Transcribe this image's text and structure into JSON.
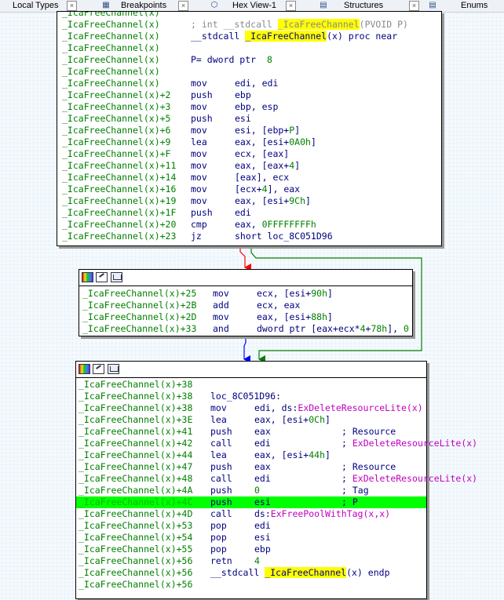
{
  "tabs": [
    {
      "label": "Local Types",
      "close": "×"
    },
    {
      "label": "Breakpoints",
      "close": "×"
    },
    {
      "label": "Hex View-1",
      "close": "×"
    },
    {
      "label": "Structures",
      "close": "×"
    },
    {
      "label": "Enums",
      "close": ""
    }
  ],
  "block1": [
    {
      "addr": "_IcaFreeChannel(x)",
      "mnem": "",
      "ops": "; int __stdcall <h>_IcaFreeChannel</h><g>(PVOID P)</g>",
      "gray": true
    },
    {
      "addr": "_IcaFreeChannel(x)",
      "mnem": "",
      "ops": "__stdcall <h>_IcaFreeChannel</h>(x) proc near"
    },
    {
      "addr": "_IcaFreeChannel(x)",
      "mnem": "",
      "ops": ""
    },
    {
      "addr": "_IcaFreeChannel(x)",
      "mnem": "",
      "ops": "P= dword ptr  <n>8</n>"
    },
    {
      "addr": "_IcaFreeChannel(x)",
      "mnem": "",
      "ops": ""
    },
    {
      "addr": "_IcaFreeChannel(x)",
      "mnem": "mov",
      "ops": "edi, edi"
    },
    {
      "addr": "_IcaFreeChannel(x)+2",
      "mnem": "push",
      "ops": "ebp"
    },
    {
      "addr": "_IcaFreeChannel(x)+3",
      "mnem": "mov",
      "ops": "ebp, esp"
    },
    {
      "addr": "_IcaFreeChannel(x)+5",
      "mnem": "push",
      "ops": "esi"
    },
    {
      "addr": "_IcaFreeChannel(x)+6",
      "mnem": "mov",
      "ops": "esi, [ebp+<n>P</n>]"
    },
    {
      "addr": "_IcaFreeChannel(x)+9",
      "mnem": "lea",
      "ops": "eax, [esi+<n>0A0h</n>]"
    },
    {
      "addr": "_IcaFreeChannel(x)+F",
      "mnem": "mov",
      "ops": "ecx, [eax]"
    },
    {
      "addr": "_IcaFreeChannel(x)+11",
      "mnem": "mov",
      "ops": "eax, [eax+<n>4</n>]"
    },
    {
      "addr": "_IcaFreeChannel(x)+14",
      "mnem": "mov",
      "ops": "[eax], ecx"
    },
    {
      "addr": "_IcaFreeChannel(x)+16",
      "mnem": "mov",
      "ops": "[ecx+<n>4</n>], eax"
    },
    {
      "addr": "_IcaFreeChannel(x)+19",
      "mnem": "mov",
      "ops": "eax, [esi+<n>9Ch</n>]"
    },
    {
      "addr": "_IcaFreeChannel(x)+1F",
      "mnem": "push",
      "ops": "edi"
    },
    {
      "addr": "_IcaFreeChannel(x)+20",
      "mnem": "cmp",
      "ops": "eax, <n>0FFFFFFFFh</n>"
    },
    {
      "addr": "_IcaFreeChannel(x)+23",
      "mnem": "jz",
      "ops": "short loc_8C051D96"
    }
  ],
  "block1_partial_top": "_IcaFreeChannel(x)",
  "block2": [
    {
      "addr": "_IcaFreeChannel(x)+25",
      "mnem": "mov",
      "ops": "ecx, [esi+<n>90h</n>]"
    },
    {
      "addr": "_IcaFreeChannel(x)+2B",
      "mnem": "add",
      "ops": "ecx, eax"
    },
    {
      "addr": "_IcaFreeChannel(x)+2D",
      "mnem": "mov",
      "ops": "eax, [esi+<n>88h</n>]"
    },
    {
      "addr": "_IcaFreeChannel(x)+33",
      "mnem": "and",
      "ops": "dword ptr [eax+ecx*<n>4</n>+<n>78h</n>], <n>0</n>"
    }
  ],
  "block3": [
    {
      "addr": "_IcaFreeChannel(x)+38",
      "mnem": "",
      "ops": ""
    },
    {
      "addr": "_IcaFreeChannel(x)+38",
      "mnem": "loc_8C051D96:",
      "ops": ""
    },
    {
      "addr": "_IcaFreeChannel(x)+38",
      "mnem": "mov",
      "ops": "edi, ds:<i>ExDeleteResourceLite(x)</i>"
    },
    {
      "addr": "_IcaFreeChannel(x)+3E",
      "mnem": "lea",
      "ops": "eax, [esi+<n>0Ch</n>]"
    },
    {
      "addr": "_IcaFreeChannel(x)+41",
      "mnem": "push",
      "ops": "eax",
      "cmt": "; Resource"
    },
    {
      "addr": "_IcaFreeChannel(x)+42",
      "mnem": "call",
      "ops": "edi",
      "cmt": "; <i>ExDeleteResourceLite(x)</i>"
    },
    {
      "addr": "_IcaFreeChannel(x)+44",
      "mnem": "lea",
      "ops": "eax, [esi+<n>44h</n>]"
    },
    {
      "addr": "_IcaFreeChannel(x)+47",
      "mnem": "push",
      "ops": "eax",
      "cmt": "; Resource"
    },
    {
      "addr": "_IcaFreeChannel(x)+48",
      "mnem": "call",
      "ops": "edi",
      "cmt": "; <i>ExDeleteResourceLite(x)</i>"
    },
    {
      "addr": "_IcaFreeChannel(x)+4A",
      "mnem": "push",
      "ops": "<n>0</n>",
      "cmt": "; Tag"
    },
    {
      "addr": "_IcaFreeChannel(x)+4C",
      "mnem": "push",
      "ops": "esi",
      "cmt": "; P",
      "current": true
    },
    {
      "addr": "_IcaFreeChannel(x)+4D",
      "mnem": "call",
      "ops": "ds:<i>ExFreePoolWithTag(x,x)</i>"
    },
    {
      "addr": "_IcaFreeChannel(x)+53",
      "mnem": "pop",
      "ops": "edi"
    },
    {
      "addr": "_IcaFreeChannel(x)+54",
      "mnem": "pop",
      "ops": "esi"
    },
    {
      "addr": "_IcaFreeChannel(x)+55",
      "mnem": "pop",
      "ops": "ebp"
    },
    {
      "addr": "_IcaFreeChannel(x)+56",
      "mnem": "retn",
      "ops": "<n>4</n>"
    },
    {
      "addr": "_IcaFreeChannel(x)+56",
      "mnem": "",
      "ops": "__stdcall <h>_IcaFreeChannel</h>(x) endp"
    },
    {
      "addr": "_IcaFreeChannel(x)+56",
      "mnem": "",
      "ops": ""
    }
  ],
  "edges": [
    {
      "from": "block1",
      "to": "block2",
      "color": "#ff0000",
      "kind": "branch-false"
    },
    {
      "from": "block2",
      "to": "block3",
      "color": "#0000ff",
      "kind": "fallthrough"
    },
    {
      "from": "block1",
      "to": "block3",
      "color": "#008000",
      "kind": "branch-true"
    }
  ],
  "colors": {
    "addr": "#008000",
    "mnem": "#000080",
    "imp": "#c000c0",
    "highlight": "#ffff00",
    "current": "#00ff00"
  }
}
